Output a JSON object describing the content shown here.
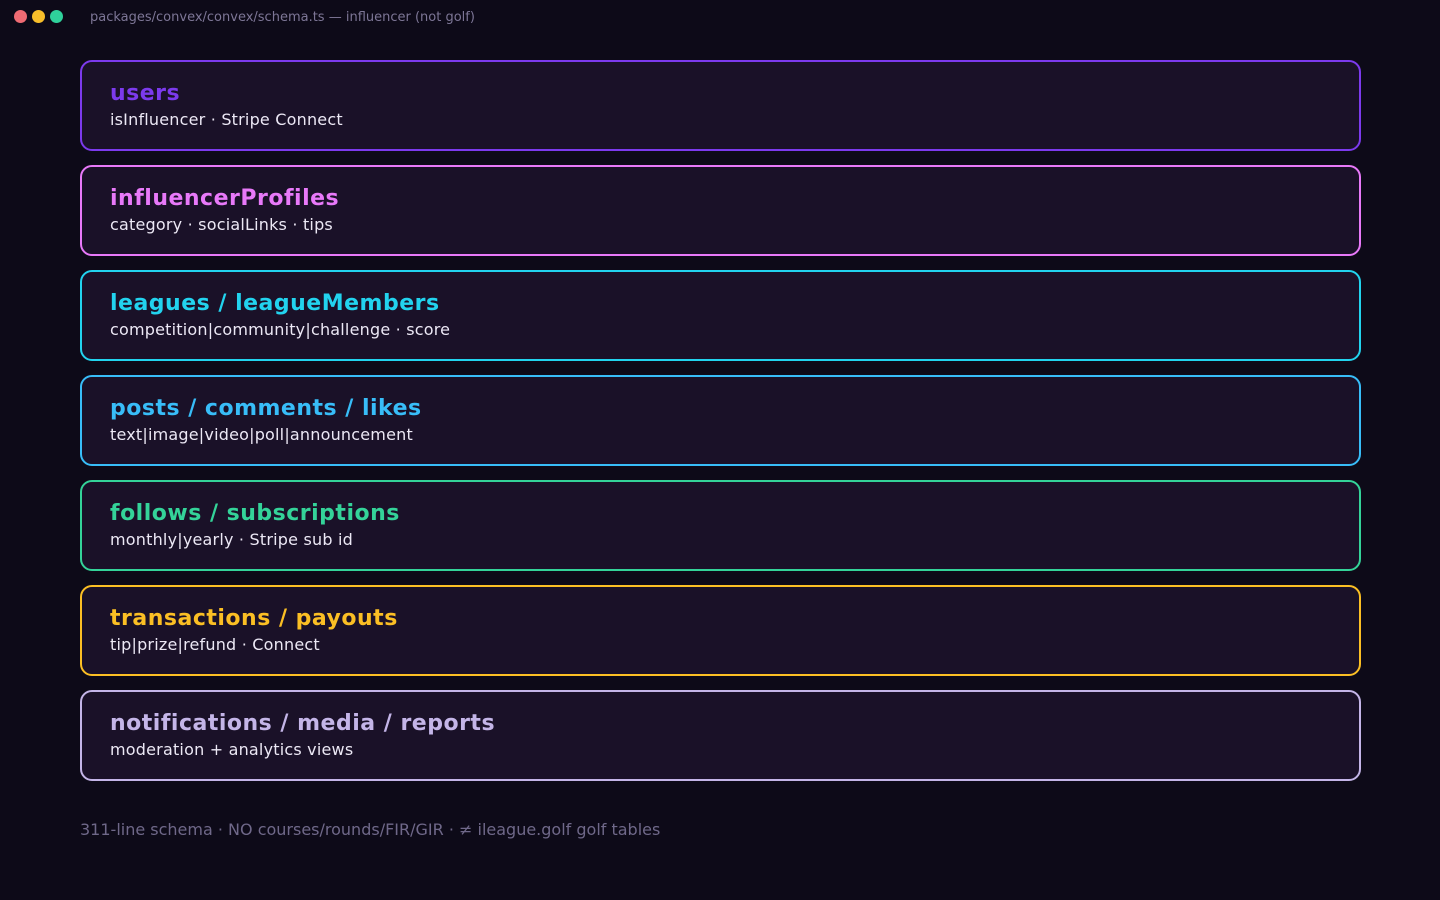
{
  "window": {
    "title": "packages/convex/convex/schema.ts — influencer (not golf)",
    "controls": [
      {
        "name": "close",
        "color": "#ef6b73"
      },
      {
        "name": "minimize",
        "color": "#f7be2a"
      },
      {
        "name": "maximize",
        "color": "#2fd19b"
      }
    ]
  },
  "tables": [
    {
      "title": "users",
      "description": "isInfluencer · Stripe Connect",
      "color": "#7c3aed"
    },
    {
      "title": "influencerProfiles",
      "description": "category · socialLinks · tips",
      "color": "#e879f9"
    },
    {
      "title": "leagues / leagueMembers",
      "description": "competition|community|challenge · score",
      "color": "#22d3ee"
    },
    {
      "title": "posts / comments / likes",
      "description": "text|image|video|poll|announcement",
      "color": "#38bdf8"
    },
    {
      "title": "follows / subscriptions",
      "description": "monthly|yearly · Stripe sub id",
      "color": "#34d399"
    },
    {
      "title": "transactions / payouts",
      "description": "tip|prize|refund · Connect",
      "color": "#fbbf24"
    },
    {
      "title": "notifications / media / reports",
      "description": "moderation + analytics views",
      "color": "#c4b5e8"
    }
  ],
  "footer": {
    "text": "311-line schema · NO courses/rounds/FIR/GIR · ≠ ileague.golf golf tables"
  }
}
